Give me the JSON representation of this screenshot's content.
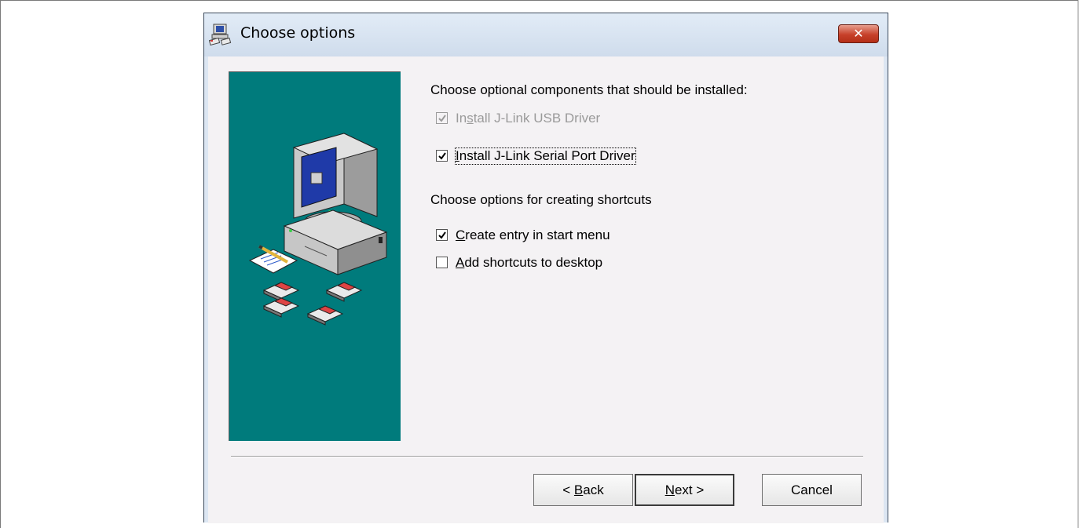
{
  "window": {
    "title": "Choose options",
    "icon": "installer-icon",
    "close_glyph": "✕"
  },
  "components": {
    "heading": "Choose optional components that should be installed:",
    "items": [
      {
        "label_pre": "In",
        "accel": "s",
        "label_post": "tall J-Link USB Driver",
        "checked": true,
        "disabled": true
      },
      {
        "label_pre": "",
        "accel": "I",
        "label_post": "nstall J-Link Serial Port Driver",
        "checked": true,
        "disabled": false
      }
    ]
  },
  "shortcuts": {
    "heading": "Choose options for creating shortcuts",
    "items": [
      {
        "label_pre": "",
        "accel": "C",
        "label_post": "reate entry in start menu",
        "checked": true
      },
      {
        "label_pre": "",
        "accel": "A",
        "label_post": "dd shortcuts to desktop",
        "checked": false
      }
    ]
  },
  "buttons": {
    "back": {
      "pre": "< ",
      "accel": "B",
      "post": "ack"
    },
    "next": {
      "pre": "",
      "accel": "N",
      "post": "ext >"
    },
    "cancel": {
      "label": "Cancel"
    }
  },
  "colors": {
    "banner": "#007b7c",
    "dialog_body": "#f4f2f4",
    "close_button": "#c7412b"
  },
  "illustration": "computer-with-floppy-disks"
}
